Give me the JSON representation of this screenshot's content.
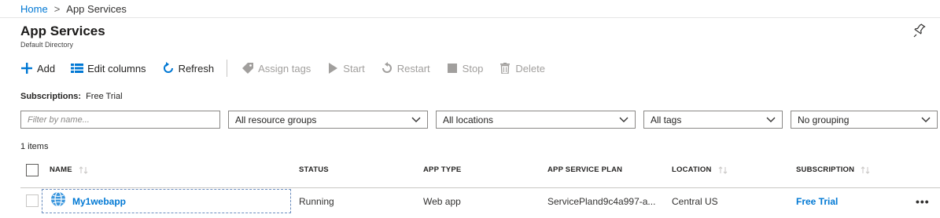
{
  "breadcrumb": {
    "home": "Home",
    "separator": ">",
    "current": "App Services"
  },
  "header": {
    "title": "App Services",
    "subtitle": "Default Directory"
  },
  "toolbar": {
    "add": "Add",
    "edit_columns": "Edit columns",
    "refresh": "Refresh",
    "assign_tags": "Assign tags",
    "start": "Start",
    "restart": "Restart",
    "stop": "Stop",
    "delete": "Delete"
  },
  "subscriptions": {
    "label": "Subscriptions:",
    "value": "Free Trial"
  },
  "filters": {
    "name_placeholder": "Filter by name...",
    "resource_groups": "All resource groups",
    "locations": "All locations",
    "tags": "All tags",
    "grouping": "No grouping"
  },
  "items_count": "1 items",
  "columns": [
    "NAME",
    "STATUS",
    "APP TYPE",
    "APP SERVICE PLAN",
    "LOCATION",
    "SUBSCRIPTION"
  ],
  "rows": [
    {
      "name": "My1webapp",
      "status": "Running",
      "app_type": "Web app",
      "plan": "ServicePland9c4a997-a...",
      "location": "Central US",
      "subscription": "Free Trial",
      "more": "•••"
    }
  ],
  "colors": {
    "accent": "#0078d4",
    "disabled": "#a19f9d",
    "border": "#8a8886"
  },
  "icons": {
    "add": "plus-icon",
    "edit_columns": "list-icon",
    "refresh": "refresh-icon",
    "assign_tags": "tag-icon",
    "start": "play-icon",
    "restart": "restart-icon",
    "stop": "stop-icon",
    "delete": "trash-icon",
    "pin": "pin-icon",
    "app": "globe-icon"
  }
}
